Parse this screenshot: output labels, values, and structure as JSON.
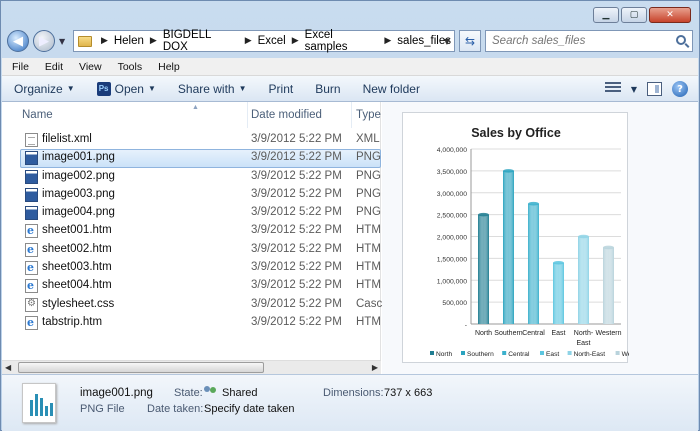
{
  "address": {
    "crumbs": [
      "Helen",
      "BIGDELL DOX",
      "Excel",
      "Excel samples",
      "sales_files"
    ]
  },
  "search": {
    "placeholder": "Search sales_files"
  },
  "menubar": [
    "File",
    "Edit",
    "View",
    "Tools",
    "Help"
  ],
  "commands": {
    "organize": "Organize",
    "open": "Open",
    "share": "Share with",
    "print": "Print",
    "burn": "Burn",
    "new_folder": "New folder"
  },
  "columns": {
    "name": "Name",
    "date": "Date modified",
    "type": "Type"
  },
  "files": [
    {
      "name": "filelist.xml",
      "date": "3/9/2012 5:22 PM",
      "type": "XML",
      "icon": "xml-file-icon"
    },
    {
      "name": "image001.png",
      "date": "3/9/2012 5:22 PM",
      "type": "PNG",
      "icon": "png-file-icon",
      "selected": true
    },
    {
      "name": "image002.png",
      "date": "3/9/2012 5:22 PM",
      "type": "PNG",
      "icon": "png-file-icon"
    },
    {
      "name": "image003.png",
      "date": "3/9/2012 5:22 PM",
      "type": "PNG",
      "icon": "png-file-icon"
    },
    {
      "name": "image004.png",
      "date": "3/9/2012 5:22 PM",
      "type": "PNG",
      "icon": "png-file-icon"
    },
    {
      "name": "sheet001.htm",
      "date": "3/9/2012 5:22 PM",
      "type": "HTM",
      "icon": "htm-file-icon"
    },
    {
      "name": "sheet002.htm",
      "date": "3/9/2012 5:22 PM",
      "type": "HTM",
      "icon": "htm-file-icon"
    },
    {
      "name": "sheet003.htm",
      "date": "3/9/2012 5:22 PM",
      "type": "HTM",
      "icon": "htm-file-icon"
    },
    {
      "name": "sheet004.htm",
      "date": "3/9/2012 5:22 PM",
      "type": "HTM",
      "icon": "htm-file-icon"
    },
    {
      "name": "stylesheet.css",
      "date": "3/9/2012 5:22 PM",
      "type": "Casc",
      "icon": "css-file-icon"
    },
    {
      "name": "tabstrip.htm",
      "date": "3/9/2012 5:22 PM",
      "type": "HTM",
      "icon": "htm-file-icon"
    }
  ],
  "chart_data": {
    "type": "bar",
    "title": "Sales by Office",
    "categories": [
      "North",
      "Southern",
      "Central",
      "East",
      "North-East",
      "Western"
    ],
    "category_labels": [
      [
        "North"
      ],
      [
        "Southern"
      ],
      [
        "Central"
      ],
      [
        "East"
      ],
      [
        "North-",
        "East"
      ],
      [
        "Western"
      ]
    ],
    "values": [
      2500000,
      3500000,
      2750000,
      1400000,
      2000000,
      1750000
    ],
    "ylim": [
      0,
      4000000
    ],
    "yticks": [
      "-",
      "500,000",
      "1,000,000",
      "1,500,000",
      "2,000,000",
      "2,500,000",
      "3,000,000",
      "3,500,000",
      "4,000,000"
    ],
    "colors": [
      "#1f7d91",
      "#2aa3bf",
      "#3bb0cc",
      "#5cc6e0",
      "#8ed3e6",
      "#b9d3dc"
    ],
    "legend": [
      "North",
      "Southern",
      "Central",
      "East",
      "North-East",
      "Western"
    ],
    "legend_position": "bottom",
    "grid": true
  },
  "details": {
    "filename": "image001.png",
    "filetype": "PNG File",
    "state_label": "State:",
    "state_value": "Shared",
    "taken_label": "Date taken:",
    "taken_value": "Specify date taken",
    "dim_label": "Dimensions:",
    "dim_value": "737 x 663"
  }
}
